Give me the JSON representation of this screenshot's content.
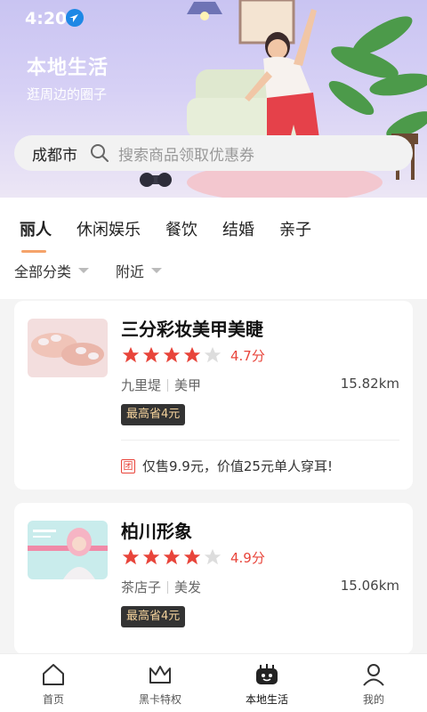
{
  "status": {
    "time": "4:20"
  },
  "hero": {
    "title": "本地生活",
    "subtitle": "逛周边的圈子"
  },
  "search": {
    "city": "成都市",
    "placeholder": "搜索商品领取优惠券"
  },
  "tabs": [
    {
      "label": "丽人",
      "active": true
    },
    {
      "label": "休闲娱乐",
      "active": false
    },
    {
      "label": "餐饮",
      "active": false
    },
    {
      "label": "结婚",
      "active": false
    },
    {
      "label": "亲子",
      "active": false
    }
  ],
  "filters": [
    {
      "label": "全部分类"
    },
    {
      "label": "附近"
    }
  ],
  "shops": [
    {
      "name": "三分彩妆美甲美睫",
      "stars": 4,
      "rating": "4.7分",
      "area": "九里堤",
      "category": "美甲",
      "distance": "15.82km",
      "badge": "最高省4元",
      "deal_icon": "团",
      "deal": "仅售9.9元，价值25元单人穿耳!"
    },
    {
      "name": "柏川形象",
      "stars": 4,
      "rating": "4.9分",
      "area": "茶店子",
      "category": "美发",
      "distance": "15.06km",
      "badge": "最高省4元"
    }
  ],
  "nav": [
    {
      "label": "首页",
      "icon": "home-icon"
    },
    {
      "label": "黑卡特权",
      "icon": "crown-icon"
    },
    {
      "label": "本地生活",
      "icon": "local-life-icon",
      "active": true
    },
    {
      "label": "我的",
      "icon": "user-icon"
    }
  ],
  "colors": {
    "accent": "#e8443a",
    "tab_underline": "#f5a36a",
    "badge_bg": "#333333",
    "badge_text": "#f4d29c"
  }
}
